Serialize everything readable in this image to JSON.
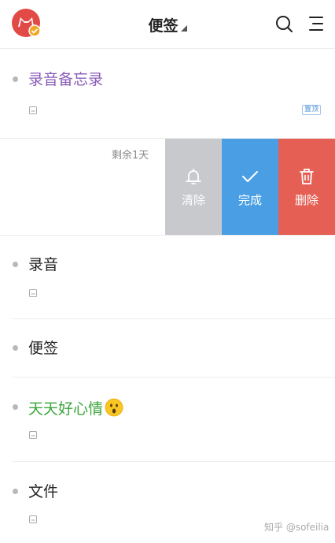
{
  "header": {
    "title": "便签",
    "avatar_icon": "cat-avatar-icon",
    "search_icon": "search-icon",
    "menu_icon": "menu-icon"
  },
  "notes": [
    {
      "title": "录音备忘录",
      "color": "#8a5cb8",
      "pinned_label": "置顶"
    },
    {
      "remaining": "剩余1天",
      "actions": {
        "clear": "清除",
        "done": "完成",
        "delete": "删除"
      }
    },
    {
      "title": "录音",
      "color": "#222222"
    },
    {
      "title": "便签",
      "color": "#222222"
    },
    {
      "title": "天天好心情",
      "color": "#3aa53a",
      "emoji": "astonished-face-emoji"
    },
    {
      "title": "文件",
      "color": "#222222"
    }
  ],
  "watermark": "知乎 @sofeilia",
  "colors": {
    "clear": "#c8c9cd",
    "done": "#4a9fe4",
    "delete": "#e55f55",
    "avatar": "#e24a45"
  }
}
